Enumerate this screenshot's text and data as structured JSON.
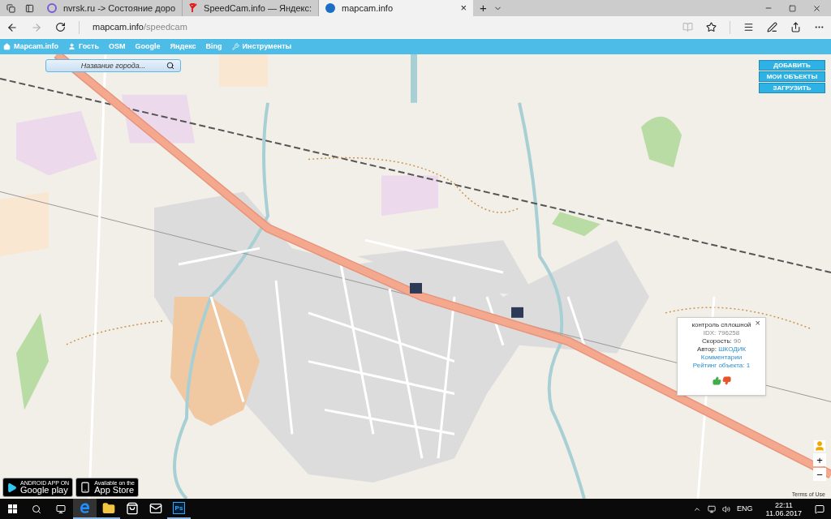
{
  "browser": {
    "tabs": [
      {
        "title": "nvrsk.ru -> Состояние доро",
        "kind": "nvrsk",
        "selected": false
      },
      {
        "title": "SpeedCam.info — Яндекс:",
        "kind": "yandex",
        "selected": false
      },
      {
        "title": "mapcam.info",
        "kind": "mapcam",
        "selected": true
      }
    ],
    "close": "×",
    "new_tab": "+",
    "address": {
      "host": "mapcam.info",
      "path": "/speedcam"
    }
  },
  "site_nav": [
    {
      "label": "Mapcam.info",
      "kind": "home"
    },
    {
      "label": "Гость",
      "kind": "user"
    },
    {
      "label": "OSM",
      "kind": "link"
    },
    {
      "label": "Google",
      "kind": "link"
    },
    {
      "label": "Яндекс",
      "kind": "link"
    },
    {
      "label": "Bing",
      "kind": "link"
    },
    {
      "label": "Инструменты",
      "kind": "tools"
    }
  ],
  "city_search": {
    "placeholder": "Название города..."
  },
  "action_buttons": [
    "ДОБАВИТЬ",
    "МОИ ОБЪЕКТЫ",
    "ЗАГРУЗИТЬ"
  ],
  "popup": {
    "title": "контроль сплошной",
    "close": "×",
    "idx_label": "IDX:",
    "idx": "796258",
    "speed_label": "Скорость:",
    "speed": "90",
    "author_label": "Автор:",
    "author": "ШКОДИК",
    "comments_link": "Комментарии",
    "rating": "Рейтинг объекта: 1"
  },
  "zoom_controls": {
    "zoom_in": "+",
    "zoom_out": "−"
  },
  "store_badges": [
    {
      "kind": "android",
      "top": "ANDROID APP ON",
      "bottom": "Google play"
    },
    {
      "kind": "apple",
      "top": "Available on the",
      "bottom": "App Store"
    }
  ],
  "map_attribution": "Terms of Use",
  "taskbar": {
    "pinned": [
      {
        "kind": "edge",
        "active": true,
        "running": true
      },
      {
        "kind": "folder",
        "active": false,
        "running": true
      },
      {
        "kind": "store",
        "active": false,
        "running": false
      },
      {
        "kind": "mail",
        "active": false,
        "running": false
      },
      {
        "kind": "photoshop",
        "label": "Ps",
        "active": false,
        "running": true
      }
    ],
    "language": "ENG",
    "time": "22:11",
    "date": "11.06.2017"
  }
}
